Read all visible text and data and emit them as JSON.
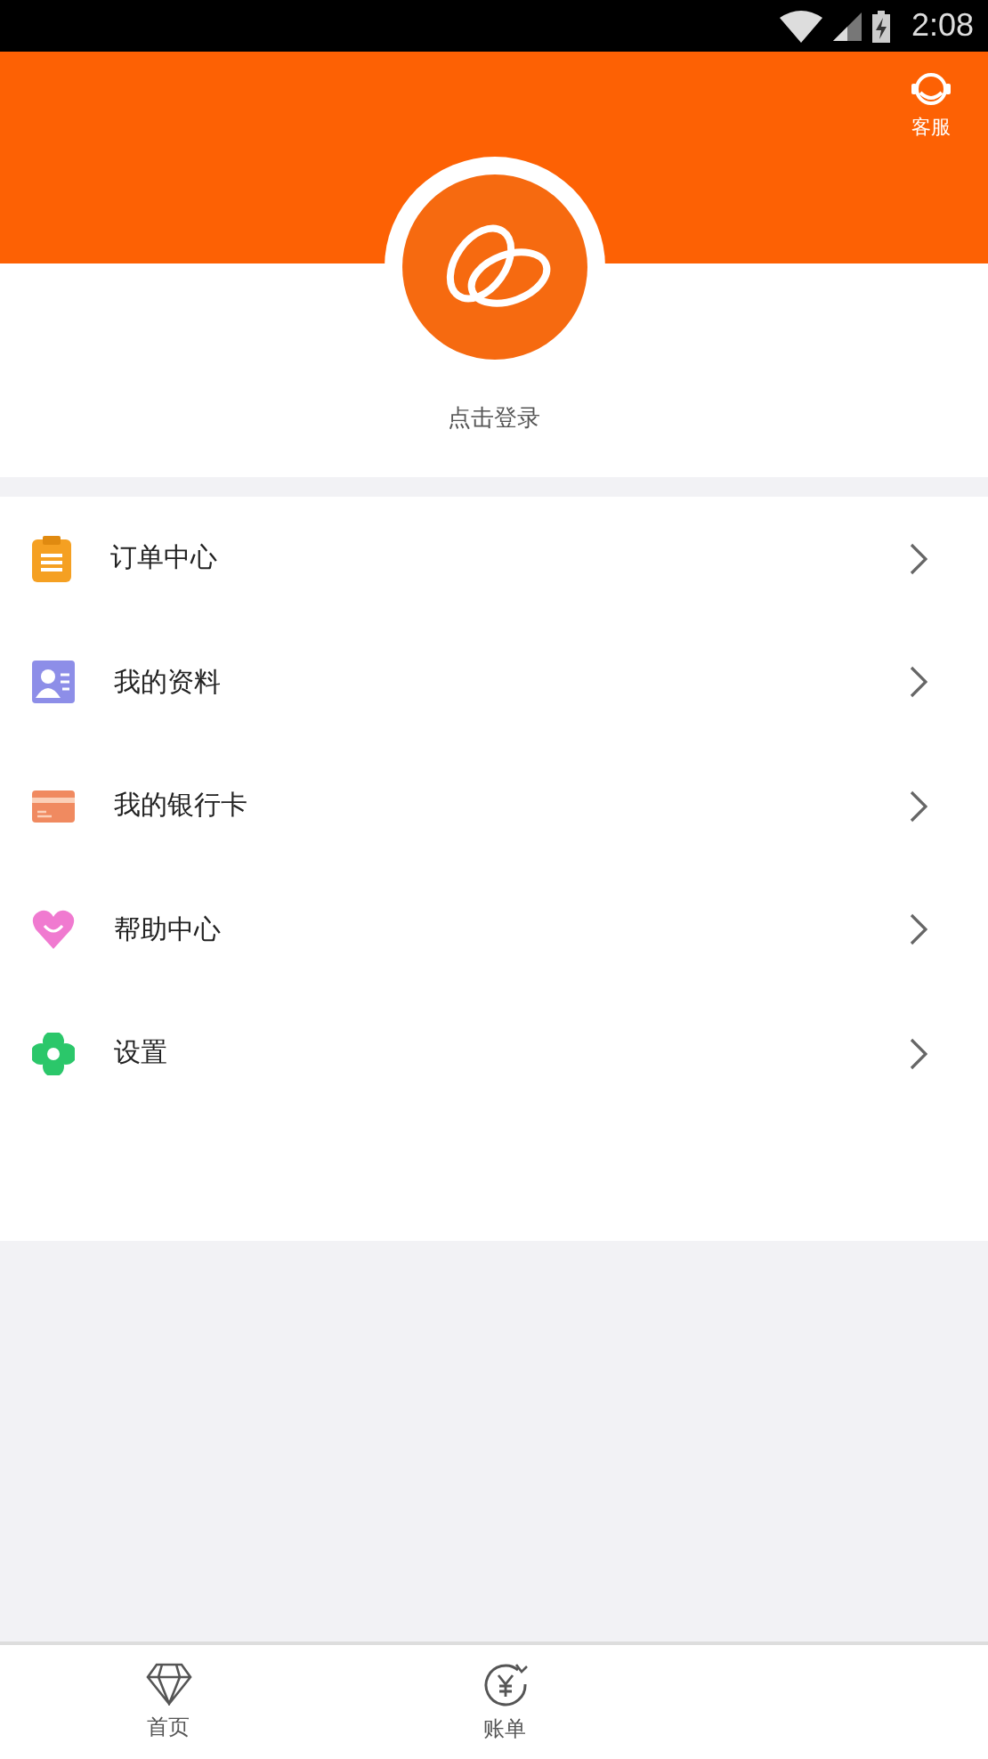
{
  "status_bar": {
    "time": "2:08"
  },
  "header": {
    "service_label": "客服"
  },
  "profile": {
    "login_label": "点击登录"
  },
  "menu": [
    {
      "kind": "order",
      "label": "订单中心"
    },
    {
      "kind": "profile",
      "label": "我的资料"
    },
    {
      "kind": "card",
      "label": "我的银行卡"
    },
    {
      "kind": "help",
      "label": "帮助中心"
    },
    {
      "kind": "settings",
      "label": "设置"
    }
  ],
  "tab_bar": [
    {
      "kind": "home",
      "label": "首页",
      "selected": false
    },
    {
      "kind": "bill",
      "label": "账单",
      "selected": false
    }
  ]
}
